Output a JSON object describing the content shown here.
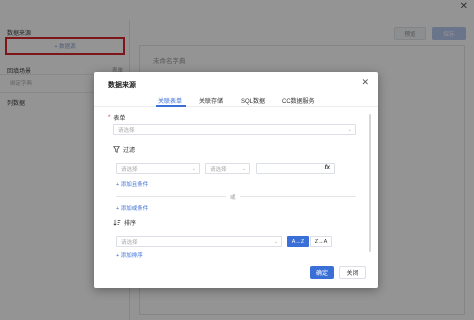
{
  "background": {
    "close_glyph": "✕",
    "left_panel": {
      "datasource_label": "数据来源",
      "add_datasource_button": "+ 数据源",
      "scene_label": "回填场景",
      "scene_side": "表单",
      "scene_placeholder": "绑定字典",
      "list_label": "列数据"
    },
    "toolbar": {
      "preview": "预览",
      "save": "保存"
    },
    "form_title": "未命名字典"
  },
  "modal": {
    "title": "数据来源",
    "close_glyph": "✕",
    "tabs": [
      {
        "label": "关联表单",
        "active": true
      },
      {
        "label": "关联存储",
        "active": false
      },
      {
        "label": "SQL数据",
        "active": false
      },
      {
        "label": "CC数据服务",
        "active": false
      }
    ],
    "form_section": {
      "required_mark": "*",
      "label": "表单",
      "select_placeholder": "请选择"
    },
    "filter_section": {
      "icon": "filter-icon",
      "label": "过滤",
      "field_placeholder": "请选择",
      "operator_placeholder": "请选择",
      "fx_label": "fx",
      "add_and_condition": "+ 添加且条件",
      "or_label": "或",
      "add_or_condition": "+ 添加或条件"
    },
    "sort_section": {
      "icon": "sort-icon",
      "label": "排序",
      "field_placeholder": "请选择",
      "asc_label": "A→Z",
      "desc_label": "Z→A",
      "add_sort": "+ 添加排序"
    },
    "footer": {
      "confirm": "确定",
      "close": "关闭"
    },
    "colors": {
      "accent": "#3a6fd8",
      "highlight_border": "#d9262c"
    }
  }
}
